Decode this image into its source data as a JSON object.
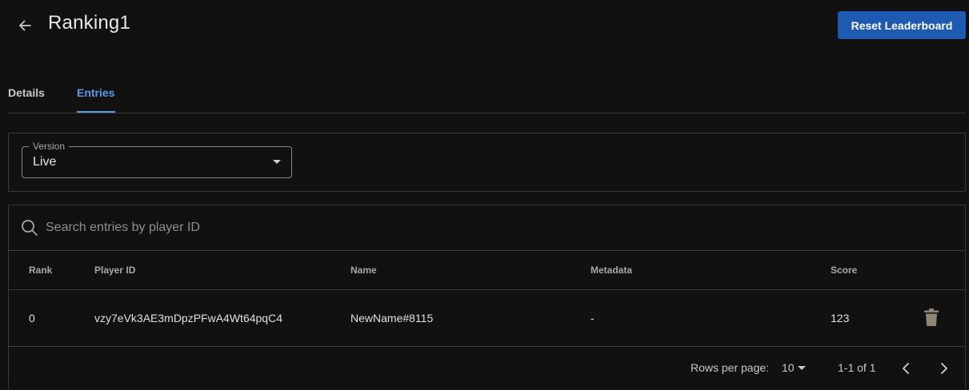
{
  "header": {
    "title": "Ranking1",
    "reset_label": "Reset Leaderboard"
  },
  "tabs": [
    {
      "label": "Details",
      "active": false
    },
    {
      "label": "Entries",
      "active": true
    }
  ],
  "version": {
    "legend": "Version",
    "value": "Live"
  },
  "search": {
    "placeholder": "Search entries by player ID"
  },
  "table": {
    "columns": [
      "Rank",
      "Player ID",
      "Name",
      "Metadata",
      "Score"
    ],
    "rows": [
      {
        "rank": "0",
        "player_id": "vzy7eVk3AE3mDpzPFwA4Wt64pqC4",
        "name": "NewName#8115",
        "metadata": "-",
        "score": "123"
      }
    ]
  },
  "pagination": {
    "rows_per_page_label": "Rows per page:",
    "rows_per_page": "10",
    "range": "1-1 of 1"
  },
  "icons": {
    "back": "arrow-left-icon",
    "search": "search-icon",
    "delete": "trash-icon",
    "prev": "chevron-left-icon",
    "next": "chevron-right-icon",
    "dropdown": "caret-down-icon"
  },
  "colors": {
    "background": "#111112",
    "accent": "#5b9bea",
    "primary_button": "#1f5ab2",
    "border": "#3a3a3c"
  }
}
